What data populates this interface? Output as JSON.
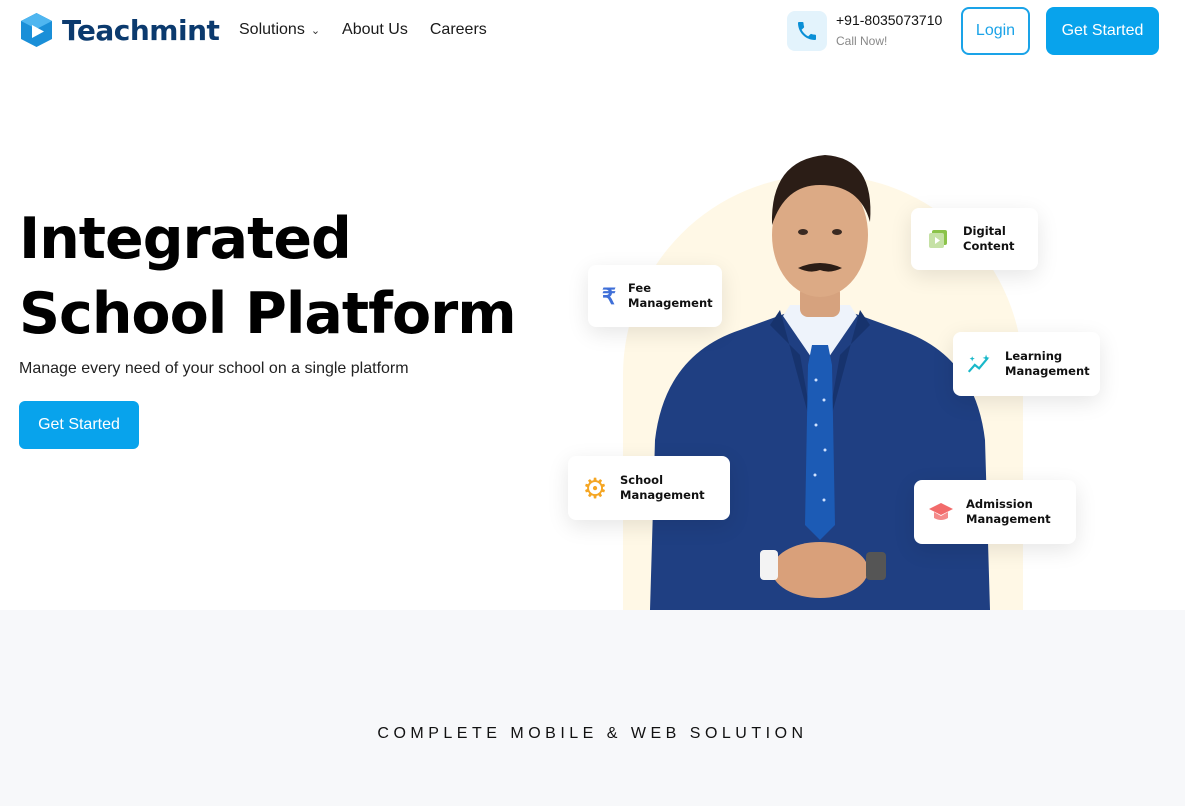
{
  "brand": {
    "name": "Teachmint",
    "logo_icon": "play-cube-icon",
    "color": "#0b3a6e"
  },
  "nav": [
    {
      "label": "Solutions",
      "has_dropdown": true
    },
    {
      "label": "About Us"
    },
    {
      "label": "Careers"
    }
  ],
  "contact": {
    "phone": "+91-8035073710",
    "sub": "Call Now!",
    "icon": "phone-icon"
  },
  "header_buttons": {
    "login": "Login",
    "get_started": "Get Started"
  },
  "hero": {
    "title_line1": "Integrated",
    "title_line2": "School Platform",
    "subtitle": "Manage every need of your school on a single platform",
    "cta": "Get Started"
  },
  "feature_cards": [
    {
      "label": "Digital\nContent",
      "icon": "video-library-icon"
    },
    {
      "label": "Fee\nManagement",
      "icon": "rupee-icon"
    },
    {
      "label": "Learning\nManagement",
      "icon": "sparkle-chart-icon"
    },
    {
      "label": "School\nManagement",
      "icon": "gear-icon"
    },
    {
      "label": "Admission\nManagement",
      "icon": "graduation-cap-icon"
    }
  ],
  "section": {
    "heading": "COMPLETE MOBILE & WEB SOLUTION"
  },
  "colors": {
    "accent": "#08a3ec",
    "band_bg": "#f7f8fa",
    "arch_bg": "#fff8e6"
  }
}
